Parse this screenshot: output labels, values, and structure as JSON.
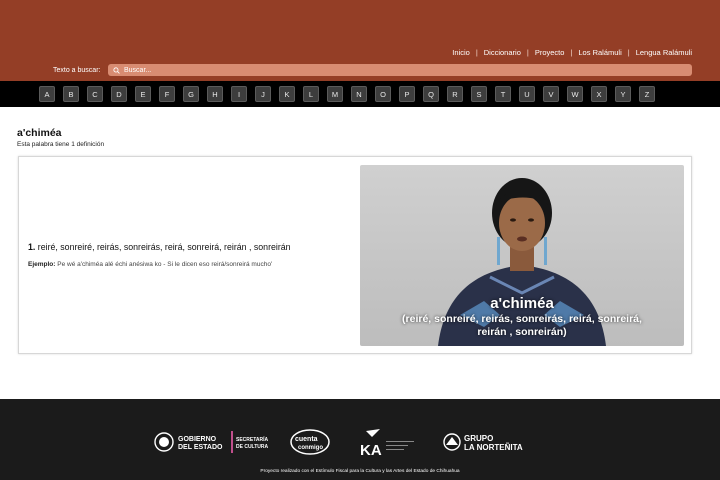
{
  "nav": {
    "items": [
      "Inicio",
      "Diccionario",
      "Proyecto",
      "Los Ralámuli",
      "Lengua Ralámuli"
    ],
    "separator": "|"
  },
  "search": {
    "label": "Texto a buscar:",
    "placeholder": "Buscar...",
    "value": ""
  },
  "alphabet": [
    "A",
    "B",
    "C",
    "D",
    "E",
    "F",
    "G",
    "H",
    "I",
    "J",
    "K",
    "L",
    "M",
    "N",
    "O",
    "P",
    "Q",
    "R",
    "S",
    "T",
    "U",
    "V",
    "W",
    "X",
    "Y",
    "Z"
  ],
  "entry": {
    "word": "a'chiméa",
    "definition_count_text": "Esta palabra tiene 1 definición",
    "definitions": [
      {
        "number": "1.",
        "text": "reiré, sonreiré, reirás, sonreirás, reirá, sonreirá, reirán , sonreirán",
        "example_label": "Ejemplo:",
        "example_text": "Pe wé a'chiméa alé échi anésiwa ko - Si le dicen eso reirá/sonreirá mucho'"
      }
    ]
  },
  "video": {
    "caption_word": "a'chiméa",
    "caption_translation": "(reiré, sonreiré, reirás, sonreirás, reirá, sonreirá, reirán , sonreirán)"
  },
  "footer": {
    "logo_gobierno_line1": "GOBIERNO",
    "logo_gobierno_line2": "DEL ESTADO",
    "logo_secretaria_line1": "SECRETARÍA",
    "logo_secretaria_line2": "DE CULTURA",
    "logo_cuenta_line1": "cuenta",
    "logo_cuenta_line2": "conmigo",
    "logo_eka": "KA",
    "logo_grupo_line1": "GRUPO",
    "logo_grupo_line2": "LA NORTEÑITA",
    "note": "Proyecto realizado con el Estímulo Fiscal para la Cultura y las Artes del Estado de Chihuahua"
  },
  "colors": {
    "header_bg": "#943e26",
    "search_bg": "#d88c72",
    "alphabet_bar_bg": "#000000",
    "alphabet_button_bg": "#3d3d3d",
    "footer_bg": "#1b1b1b"
  }
}
